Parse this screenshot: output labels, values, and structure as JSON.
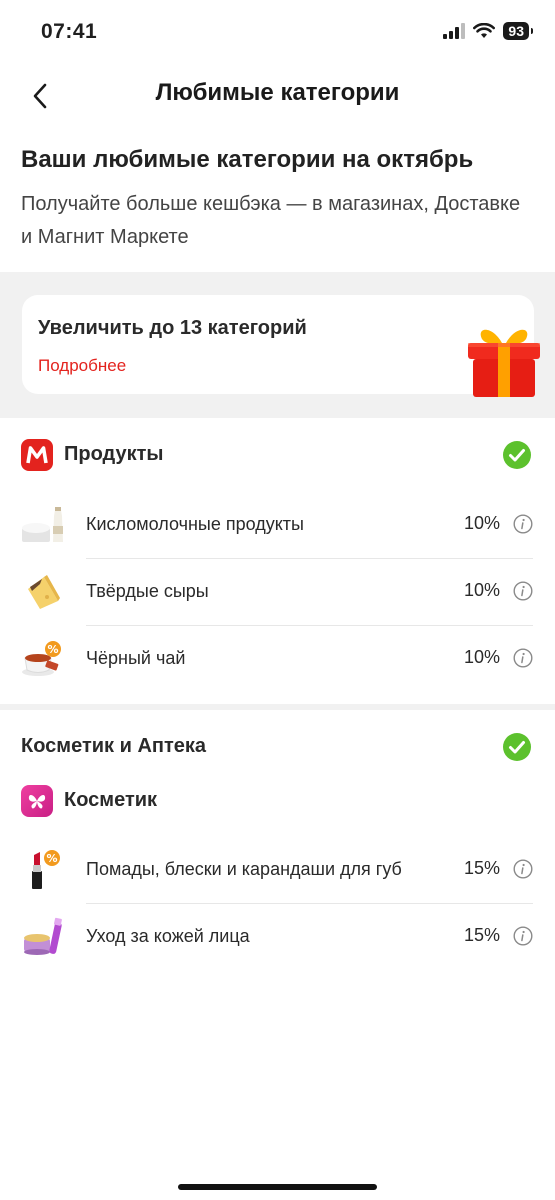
{
  "status_bar": {
    "time": "07:41",
    "battery": "93"
  },
  "header": {
    "title": "Любимые категории",
    "back_icon": "chevron-left-icon"
  },
  "intro": {
    "title": "Ваши любимые категории на октябрь",
    "subtitle": "Получайте больше кешбэка — в магазинах, Доставке и Магнит Маркете"
  },
  "promo": {
    "title": "Увеличить до 13 категорий",
    "link": "Подробнее",
    "link_color": "#e3231e",
    "icon": "gift-icon"
  },
  "sections": [
    {
      "title": "Продукты",
      "brand_icon": "magnit-logo-icon",
      "brand_color": "#e3231e",
      "selected": true,
      "items": [
        {
          "label": "Кисломолочные продукты",
          "percent": "10%",
          "icon": "dairy-icon"
        },
        {
          "label": "Твёрдые сыры",
          "percent": "10%",
          "icon": "cheese-icon"
        },
        {
          "label": "Чёрный чай",
          "percent": "10%",
          "icon": "tea-cup-icon"
        }
      ]
    },
    {
      "title": "Косметик и Аптека",
      "selected": true,
      "subgroup": {
        "title": "Косметик",
        "brand_icon": "magnit-cosmetic-logo-icon",
        "brand_color": "#d9298f"
      },
      "items": [
        {
          "label": "Помады, блески и карандаши для губ",
          "percent": "15%",
          "icon": "lipstick-icon"
        },
        {
          "label": "Уход за кожей лица",
          "percent": "15%",
          "icon": "face-cream-icon"
        }
      ]
    }
  ],
  "colors": {
    "accent_red": "#e3231e",
    "check_green": "#5cc12d",
    "cosmetic_pink": "#d9298f"
  }
}
